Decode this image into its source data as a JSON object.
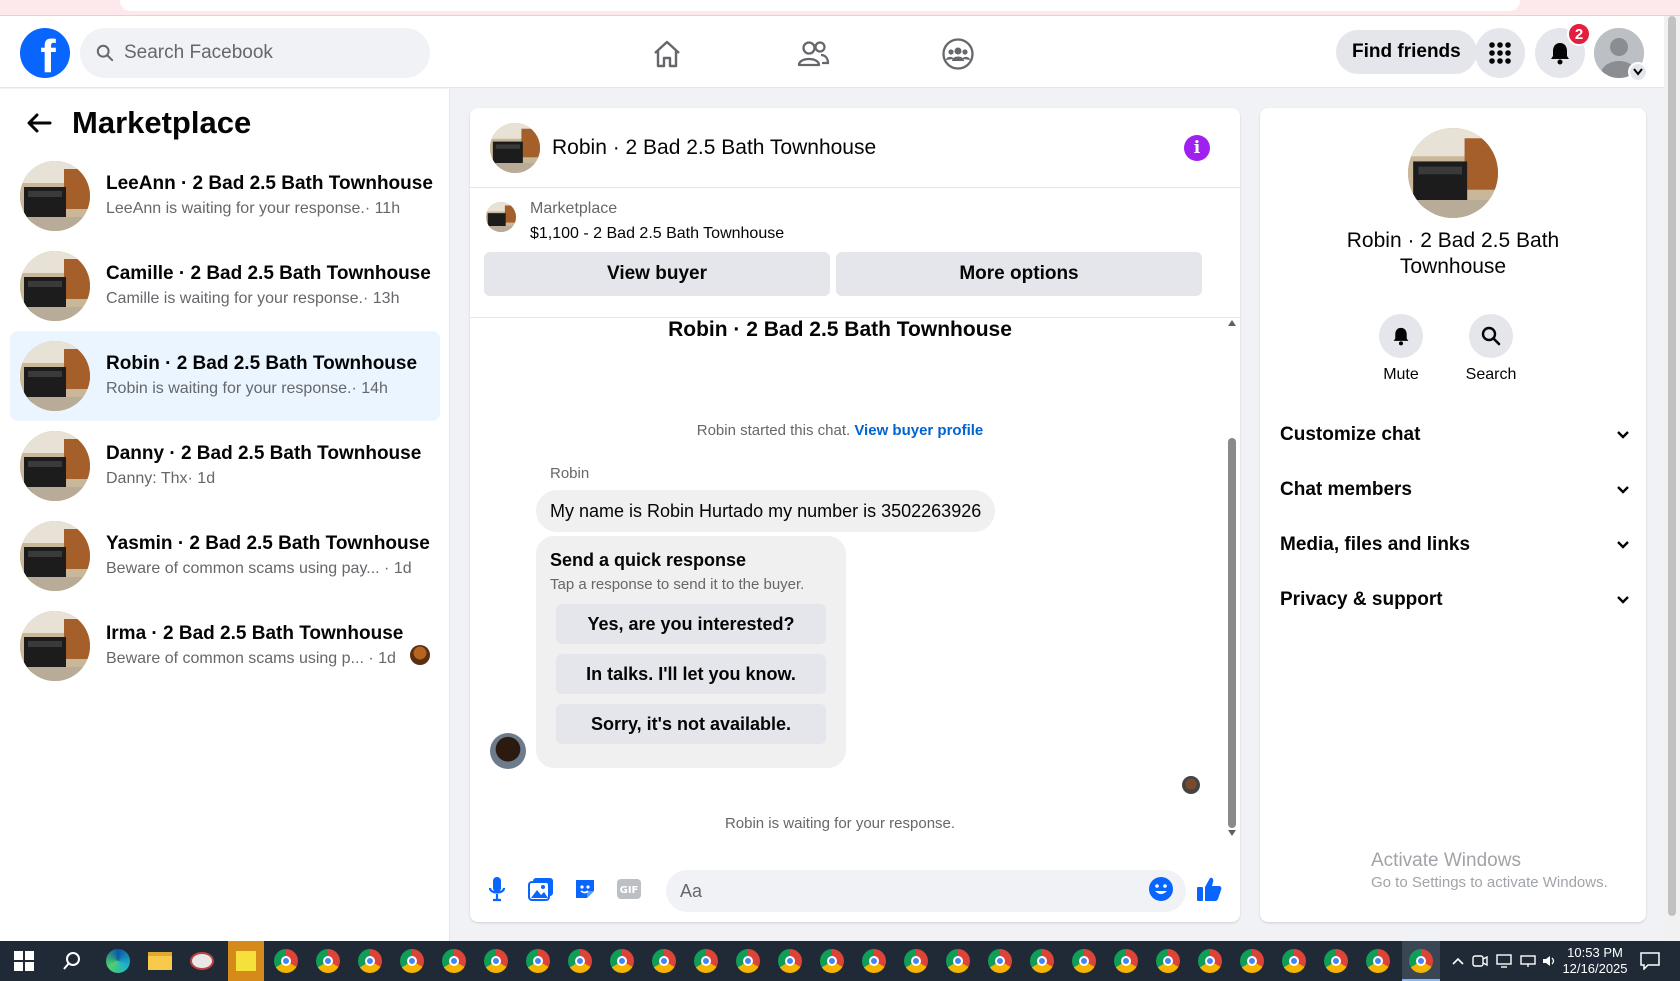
{
  "header": {
    "search_placeholder": "Search Facebook",
    "find_friends_label": "Find friends",
    "notification_count": "2"
  },
  "sidebar": {
    "title": "Marketplace",
    "conversations": [
      {
        "name": "LeeAnn · 2 Bad 2.5 Bath Townhouse",
        "preview": "LeeAnn is waiting for your response.",
        "time": "· 11h"
      },
      {
        "name": "Camille · 2 Bad 2.5 Bath Townhouse",
        "preview": "Camille is waiting for your response.",
        "time": "· 13h"
      },
      {
        "name": "Robin · 2 Bad 2.5 Bath Townhouse",
        "preview": "Robin is waiting for your response.",
        "time": "· 14h"
      },
      {
        "name": "Danny · 2 Bad 2.5 Bath Townhouse",
        "preview": "Danny: Thx",
        "time": "· 1d"
      },
      {
        "name": "Yasmin · 2 Bad 2.5 Bath Townhouse",
        "preview": "Beware of common scams using pay...",
        "time": "· 1d"
      },
      {
        "name": "Irma · 2 Bad 2.5 Bath Townhouse",
        "preview": "Beware of common scams using p...",
        "time": "· 1d"
      }
    ]
  },
  "chat": {
    "title": "Robin · 2 Bad 2.5 Bath Townhouse",
    "listing_label": "Marketplace",
    "listing_price": "$1,100 - 2 Bad 2.5 Bath Townhouse",
    "view_buyer_label": "View buyer",
    "more_options_label": "More options",
    "thread_title": "Robin · 2 Bad 2.5 Bath Townhouse",
    "started_text": "Robin started this chat.",
    "view_buyer_profile": "View buyer profile",
    "sender_name": "Robin",
    "message": "My name is Robin Hurtado my number is 3502263926",
    "quick_title": "Send a quick response",
    "quick_sub": "Tap a response to send it to the buyer.",
    "quick_responses": [
      "Yes, are you interested?",
      "In talks. I'll let you know.",
      "Sorry, it's not available."
    ],
    "waiting_text": "Robin is waiting for your response.",
    "composer_placeholder": "Aa"
  },
  "right_panel": {
    "name": "Robin · 2 Bad 2.5 Bath Townhouse",
    "mute_label": "Mute",
    "search_label": "Search",
    "sections": [
      "Customize chat",
      "Chat members",
      "Media, files and links",
      "Privacy & support"
    ]
  },
  "watermark": {
    "line1": "Activate Windows",
    "line2": "Go to Settings to activate Windows."
  },
  "taskbar": {
    "time": "10:53 PM",
    "date": "12/16/2025"
  },
  "colors": {
    "brand": "#0866ff",
    "info": "#a020f0",
    "link": "#0064d1",
    "active_row": "#ebf5ff"
  }
}
